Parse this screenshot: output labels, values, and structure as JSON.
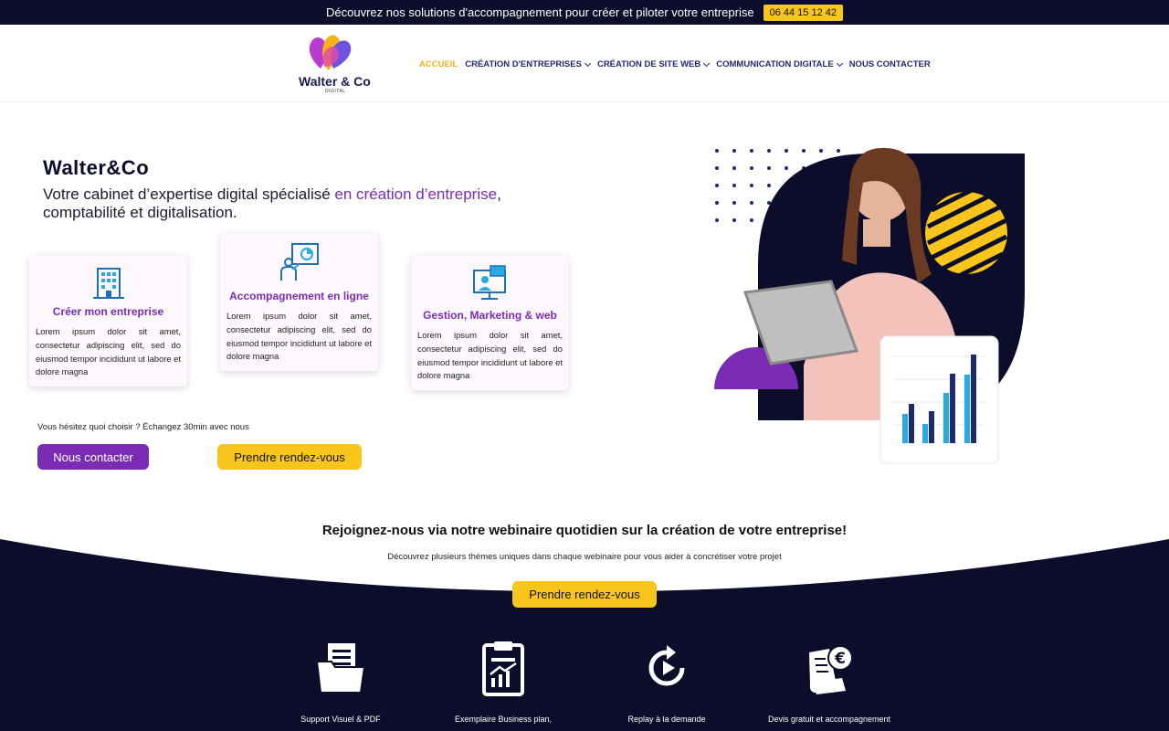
{
  "topbar": {
    "text": "Découvrez nos solutions d'accompagnement pour créer et piloter votre entreprise",
    "phone": "06 44 15 12 42"
  },
  "logo": {
    "brand": "Walter & Co",
    "sub": "DIGITAL"
  },
  "nav": {
    "items": [
      {
        "label": "ACCUEIL",
        "active": true,
        "has_dropdown": false
      },
      {
        "label": "CRÉATION D'ENTREPRISES",
        "has_dropdown": true
      },
      {
        "label": "CRÉATION DE SITE WEB",
        "has_dropdown": true
      },
      {
        "label": "COMMUNICATION DIGITALE",
        "has_dropdown": true
      },
      {
        "label": "NOUS CONTACTER",
        "has_dropdown": false
      }
    ]
  },
  "hero": {
    "title": "Walter&Co",
    "subtitle_pre": "Votre cabinet d’expertise digital spécialisé ",
    "subtitle_highlight": "en création d’entreprise",
    "subtitle_post": ", comptabilité et digitalisation."
  },
  "cards": [
    {
      "title": "Créer mon entreprise",
      "icon": "building-icon",
      "text": "Lorem ipsum dolor sit amet, consectetur adipiscing elit, sed do eiusmod tempor incididunt ut labore et dolore magna"
    },
    {
      "title": "Accompagnement en ligne",
      "icon": "presentation-icon",
      "text": "Lorem ipsum dolor sit amet, consectetur adipiscing elit, sed do eiusmod tempor incididunt ut labore et dolore magna"
    },
    {
      "title": "Gestion, Marketing & web",
      "icon": "monitor-chat-icon",
      "text": "Lorem ipsum dolor sit amet, consectetur adipiscing elit, sed do eiusmod tempor incididunt ut labore et dolore magna"
    }
  ],
  "cta": {
    "hesitate": "Vous hésitez quoi choisir ? Échangez 30min avec nous",
    "contact": "Nous contacter",
    "rdv": "Prendre rendez-vous"
  },
  "webinar": {
    "title": "Rejoignez-nous via notre webinaire quotidien sur la création de votre entreprise!",
    "subtitle": "Découvrez plusieurs thèmes uniques dans chaque webinaire pour vous aider à concrétiser votre projet",
    "button": "Prendre rendez-vous"
  },
  "features": [
    {
      "label": "Support Visuel & PDF",
      "icon": "folder-document-icon"
    },
    {
      "label": "Exemplaire Business plan,",
      "icon": "clipboard-chart-icon"
    },
    {
      "label": "Replay à la demande",
      "icon": "replay-icon"
    },
    {
      "label": "Devis gratuit et accompagnement",
      "icon": "invoice-euro-icon"
    }
  ],
  "colors": {
    "navy": "#0b0d2a",
    "purple": "#7b2cb5",
    "yellow": "#f8c51c",
    "nav_blue": "#1e2a6e",
    "nav_active": "#f5b01c"
  }
}
